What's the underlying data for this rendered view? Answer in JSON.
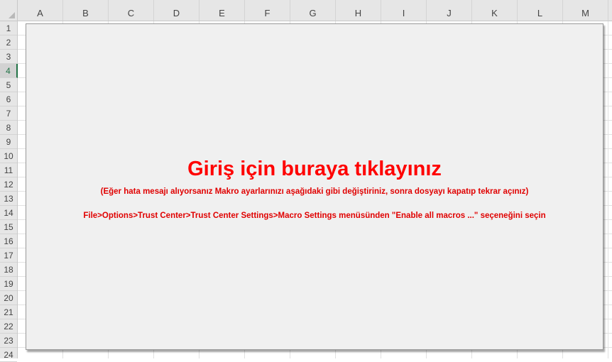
{
  "columns": [
    "A",
    "B",
    "C",
    "D",
    "E",
    "F",
    "G",
    "H",
    "I",
    "J",
    "K",
    "L",
    "M"
  ],
  "rows": [
    "1",
    "2",
    "3",
    "4",
    "5",
    "6",
    "7",
    "8",
    "9",
    "10",
    "11",
    "12",
    "13",
    "14",
    "15",
    "16",
    "17",
    "18",
    "19",
    "20",
    "21",
    "22",
    "23",
    "24"
  ],
  "active_row": "4",
  "panel": {
    "title": "Giriş için buraya tıklayınız",
    "subtitle": "(Eğer hata mesajı alıyorsanız Makro ayarlarınızı aşağıdaki gibi değiştiriniz, sonra dosyayı kapatıp tekrar açınız)",
    "instruction": "File>Options>Trust Center>Trust Center Settings>Macro Settings menüsünden \"Enable all macros ...\" seçeneğini seçin"
  },
  "colors": {
    "title": "#ff0000",
    "text": "#e00000",
    "panel_bg": "#f0f0f0",
    "active_row": "#217346"
  }
}
